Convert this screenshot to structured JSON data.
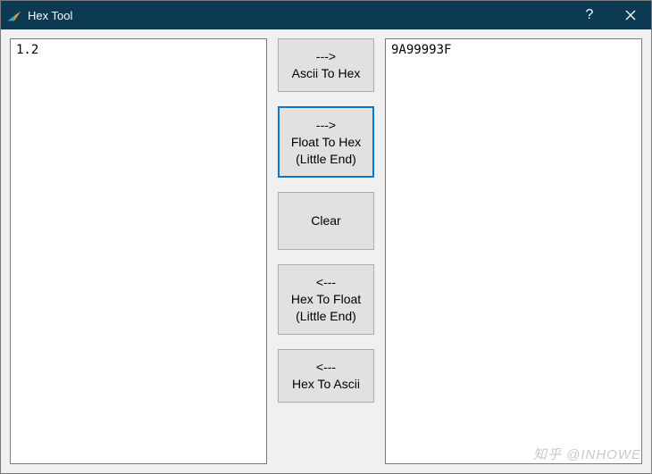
{
  "window": {
    "title": "Hex Tool",
    "help_tooltip": "?",
    "close_tooltip": "Close"
  },
  "input": {
    "value": "1.2"
  },
  "output": {
    "value": "9A99993F"
  },
  "buttons": {
    "ascii_to_hex": {
      "arrow": "--->",
      "label": "Ascii To Hex",
      "selected": false
    },
    "float_to_hex": {
      "arrow": "--->",
      "label": "Float To Hex",
      "sub": "(Little End)",
      "selected": true
    },
    "clear": {
      "label": "Clear",
      "selected": false
    },
    "hex_to_float": {
      "arrow": "<---",
      "label": "Hex To Float",
      "sub": "(Little End)",
      "selected": false
    },
    "hex_to_ascii": {
      "arrow": "<---",
      "label": "Hex To Ascii",
      "selected": false
    }
  },
  "watermark": "知乎 @INHOWE"
}
